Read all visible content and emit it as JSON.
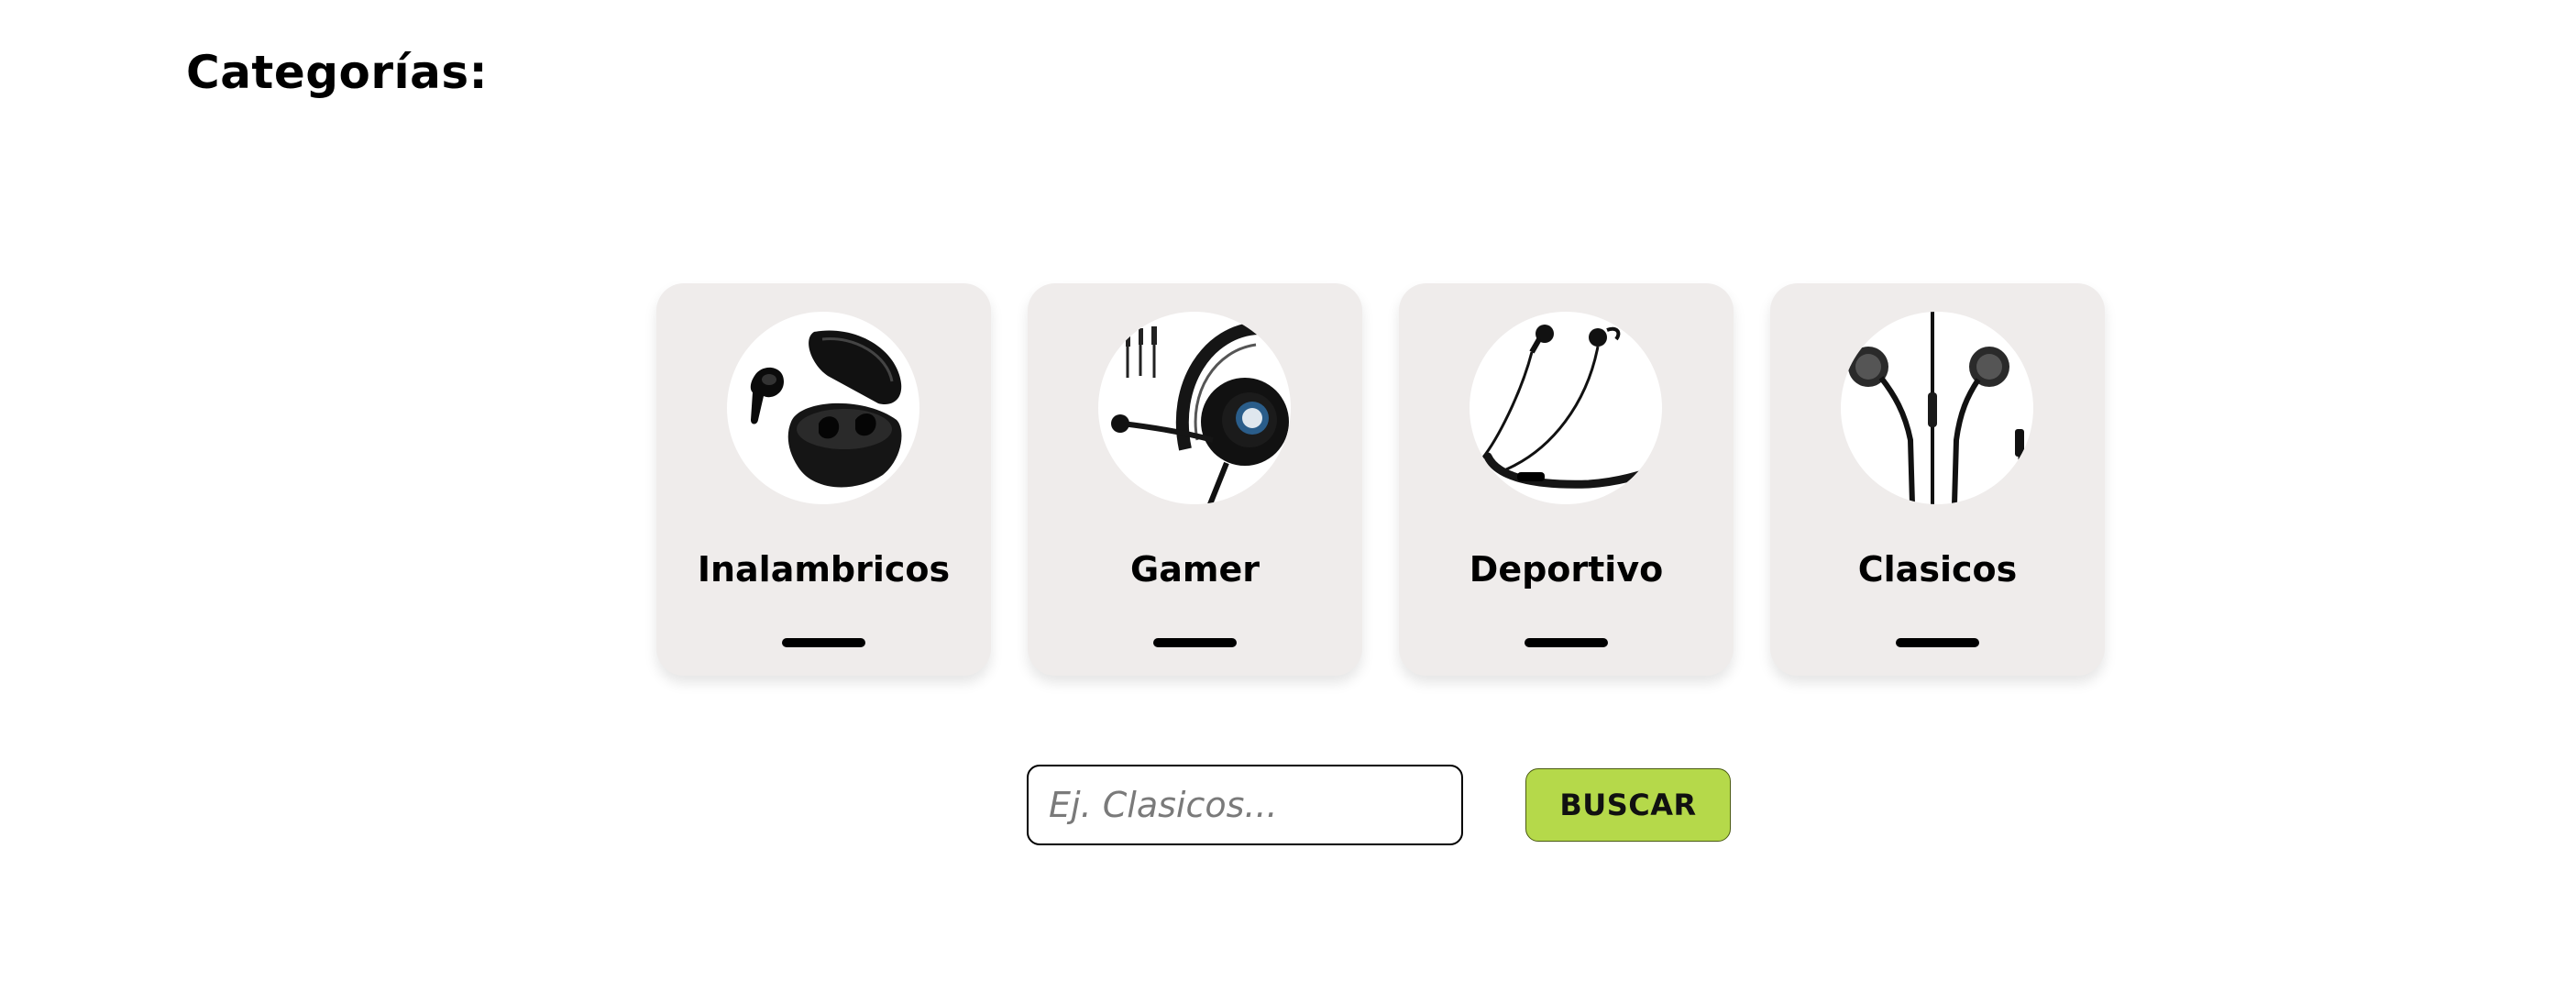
{
  "header": {
    "title": "Categorías:"
  },
  "categories": [
    {
      "label": "Inalambricos",
      "icon": "wireless-earbuds-icon"
    },
    {
      "label": "Gamer",
      "icon": "gaming-headset-icon"
    },
    {
      "label": "Deportivo",
      "icon": "sport-neckband-earphones-icon"
    },
    {
      "label": "Clasicos",
      "icon": "wired-earphones-icon"
    }
  ],
  "search": {
    "placeholder": "Ej. Clasicos...",
    "value": "",
    "button_label": "BUSCAR"
  },
  "colors": {
    "card_background": "#efeceb",
    "button_background": "#b5d94a",
    "text": "#000000"
  }
}
